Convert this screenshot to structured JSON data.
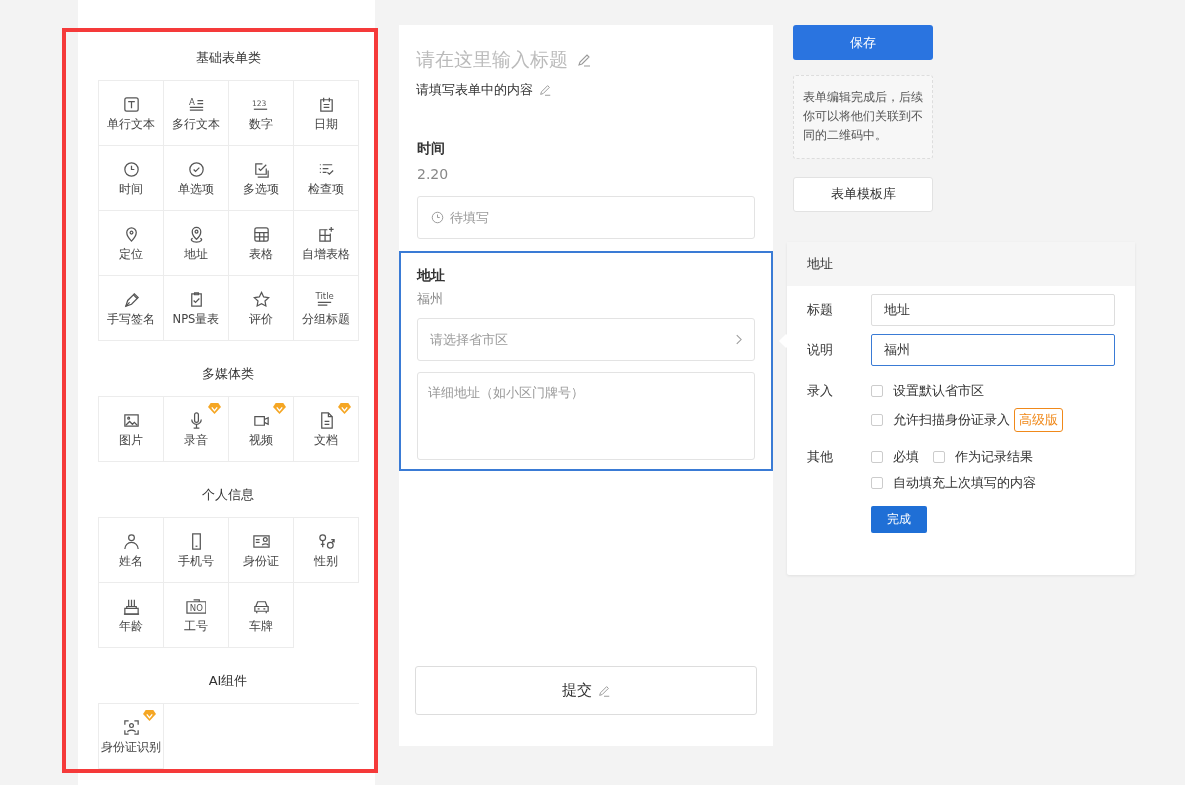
{
  "palette": {
    "groups": [
      {
        "title": "基础表单类",
        "items": [
          {
            "label": "单行文本",
            "premium": false
          },
          {
            "label": "多行文本",
            "premium": false,
            "icon_text": "A"
          },
          {
            "label": "数字",
            "premium": false,
            "icon_text": "123"
          },
          {
            "label": "日期",
            "premium": false
          },
          {
            "label": "时间",
            "premium": false
          },
          {
            "label": "单选项",
            "premium": false
          },
          {
            "label": "多选项",
            "premium": false
          },
          {
            "label": "检查项",
            "premium": false
          },
          {
            "label": "定位",
            "premium": false
          },
          {
            "label": "地址",
            "premium": false
          },
          {
            "label": "表格",
            "premium": false
          },
          {
            "label": "自增表格",
            "premium": false
          },
          {
            "label": "手写签名",
            "premium": false
          },
          {
            "label": "NPS量表",
            "premium": false
          },
          {
            "label": "评价",
            "premium": false
          },
          {
            "label": "分组标题",
            "premium": false,
            "icon_text": "Title"
          }
        ]
      },
      {
        "title": "多媒体类",
        "items": [
          {
            "label": "图片",
            "premium": false
          },
          {
            "label": "录音",
            "premium": true
          },
          {
            "label": "视频",
            "premium": true
          },
          {
            "label": "文档",
            "premium": true
          }
        ]
      },
      {
        "title": "个人信息",
        "items": [
          {
            "label": "姓名",
            "premium": false
          },
          {
            "label": "手机号",
            "premium": false
          },
          {
            "label": "身份证",
            "premium": false
          },
          {
            "label": "性别",
            "premium": false
          },
          {
            "label": "年龄",
            "premium": false
          },
          {
            "label": "工号",
            "premium": false,
            "icon_text": "NO"
          },
          {
            "label": "车牌",
            "premium": false
          }
        ]
      },
      {
        "title": "AI组件",
        "items": [
          {
            "label": "身份证识别",
            "premium": true
          }
        ]
      }
    ]
  },
  "form": {
    "title_placeholder": "请在这里输入标题",
    "subtitle": "请填写表单中的内容",
    "fields": [
      {
        "kind": "time",
        "selected": false,
        "title": "时间",
        "description": "2.20",
        "placeholder": "待填写"
      },
      {
        "kind": "address",
        "selected": true,
        "title": "地址",
        "description": "福州",
        "region_placeholder": "请选择省市区",
        "detail_placeholder": "详细地址（如小区门牌号）"
      }
    ],
    "submit": "提交"
  },
  "side": {
    "save": "保存",
    "tip": "表单编辑完成后，后续你可以将他们关联到不同的二维码中。",
    "templates": "表单模板库"
  },
  "properties": {
    "header": "地址",
    "title_label": "标题",
    "title_value": "地址",
    "desc_label": "说明",
    "desc_value": "福州",
    "input_label": "录入",
    "input_options": [
      {
        "label": "设置默认省市区",
        "checked": false
      },
      {
        "label": "允许扫描身份证录入",
        "checked": false,
        "tag": "高级版"
      }
    ],
    "other_label": "其他",
    "other_options": [
      {
        "label": "必填",
        "checked": false
      },
      {
        "label": "作为记录结果",
        "checked": false
      },
      {
        "label": "自动填充上次填写的内容",
        "checked": false
      }
    ],
    "done": "完成"
  }
}
